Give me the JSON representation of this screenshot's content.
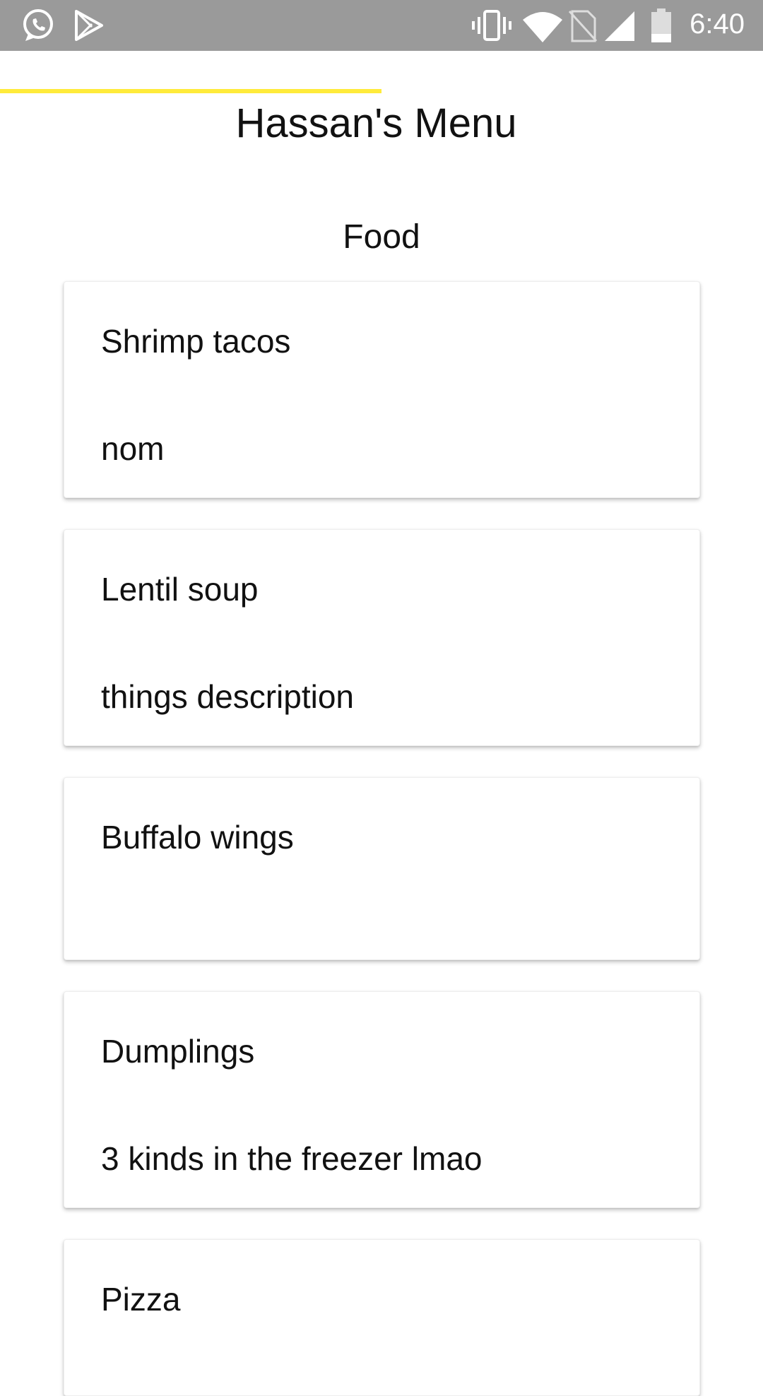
{
  "status_bar": {
    "time": "6:40",
    "left_icons": [
      "whatsapp-icon",
      "play-store-icon"
    ],
    "right_icons": [
      "vibrate-icon",
      "wifi-icon",
      "no-sim-icon",
      "cell-signal-icon",
      "battery-icon"
    ],
    "background": "#9a9a9a"
  },
  "progress": {
    "fraction": 0.5,
    "color": "#ffeb3b"
  },
  "header": {
    "title": "Hassan's Menu"
  },
  "section": {
    "title": "Food"
  },
  "menu_items": [
    {
      "name": "Shrimp tacos",
      "description": "nom"
    },
    {
      "name": "Lentil soup",
      "description": "things description"
    },
    {
      "name": "Buffalo wings",
      "description": ""
    },
    {
      "name": "Dumplings",
      "description": "3 kinds in the freezer lmao"
    },
    {
      "name": "Pizza",
      "description": ""
    }
  ]
}
